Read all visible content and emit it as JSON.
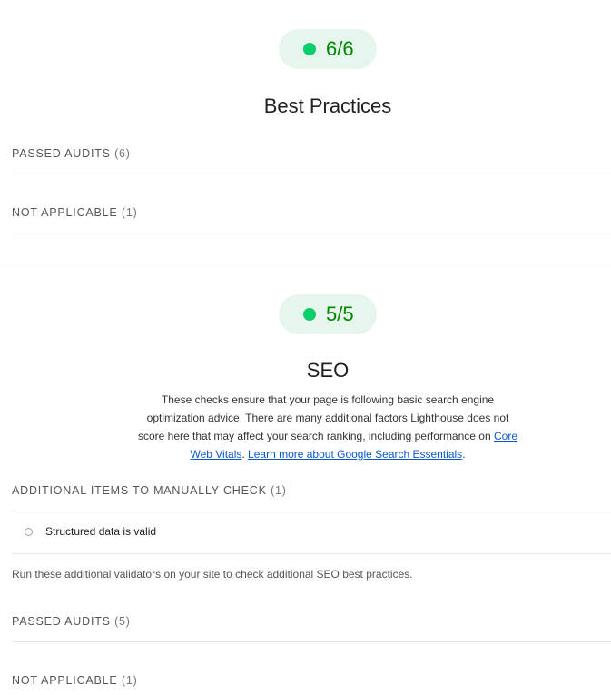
{
  "best_practices": {
    "score": "6/6",
    "title": "Best Practices",
    "groups": [
      {
        "label": "PASSED AUDITS",
        "count": "(6)"
      },
      {
        "label": "NOT APPLICABLE",
        "count": "(1)"
      }
    ]
  },
  "seo": {
    "score": "5/5",
    "title": "SEO",
    "description": {
      "text": "These checks ensure that your page is following basic search engine optimization advice. There are many additional factors Lighthouse does not score here that may affect your search ranking, including performance on ",
      "link1": "Core Web Vitals",
      "sep": ". ",
      "link2": "Learn more about Google Search Essentials",
      "end": "."
    },
    "manual_group": {
      "label": "ADDITIONAL ITEMS TO MANUALLY CHECK",
      "count": "(1)"
    },
    "manual_audit": "Structured data is valid",
    "manual_note": "Run these additional validators on your site to check additional SEO best practices.",
    "groups": [
      {
        "label": "PASSED AUDITS",
        "count": "(5)"
      },
      {
        "label": "NOT APPLICABLE",
        "count": "(1)"
      }
    ]
  },
  "colors": {
    "pass": "#0cce6b",
    "pass_bg": "#e6f6ec",
    "score_text": "#008800",
    "link": "#0b57d0"
  }
}
